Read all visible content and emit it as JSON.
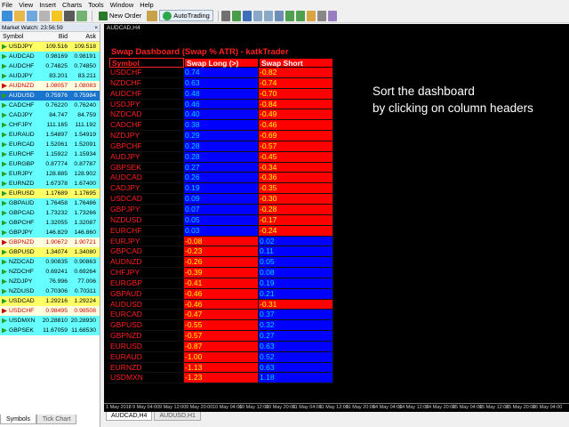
{
  "menu": [
    "File",
    "View",
    "Insert",
    "Charts",
    "Tools",
    "Window",
    "Help"
  ],
  "toolbar": {
    "new_order": "New Order",
    "autotrading": "AutoTrading"
  },
  "market_watch": {
    "title": "Market Watch: 23:56:59",
    "close": "×",
    "headers": {
      "symbol": "Symbol",
      "bid": "Bid",
      "ask": "Ask"
    },
    "rows": [
      {
        "symbol": "USDJPY",
        "bid": "109.516",
        "ask": "109.518",
        "bg": "#ffff66",
        "color": "#000000"
      },
      {
        "symbol": "AUDCAD",
        "bid": "0.98169",
        "ask": "0.98191",
        "bg": "#66ffff",
        "color": "#000000"
      },
      {
        "symbol": "AUDCHF",
        "bid": "0.74825",
        "ask": "0.74850",
        "bg": "#66ffff",
        "color": "#000000"
      },
      {
        "symbol": "AUDJPY",
        "bid": "83.201",
        "ask": "83.211",
        "bg": "#66ffff",
        "color": "#000000"
      },
      {
        "symbol": "AUDNZD",
        "bid": "1.08057",
        "ask": "1.08083",
        "bg": "#ffffe0",
        "color": "#cc0000"
      },
      {
        "symbol": "AUDUSD",
        "bid": "0.75976",
        "ask": "0.75984",
        "bg": "#1874cd",
        "color": "#ffffff"
      },
      {
        "symbol": "CADCHF",
        "bid": "0.76220",
        "ask": "0.76240",
        "bg": "#66ffff",
        "color": "#000000"
      },
      {
        "symbol": "CADJPY",
        "bid": "84.747",
        "ask": "84.759",
        "bg": "#66ffff",
        "color": "#000000"
      },
      {
        "symbol": "CHFJPY",
        "bid": "111.165",
        "ask": "111.192",
        "bg": "#66ffff",
        "color": "#000000"
      },
      {
        "symbol": "EURAUD",
        "bid": "1.54897",
        "ask": "1.54919",
        "bg": "#66ffff",
        "color": "#000000"
      },
      {
        "symbol": "EURCAD",
        "bid": "1.52061",
        "ask": "1.52091",
        "bg": "#66ffff",
        "color": "#000000"
      },
      {
        "symbol": "EURCHF",
        "bid": "1.15922",
        "ask": "1.15934",
        "bg": "#66ffff",
        "color": "#000000"
      },
      {
        "symbol": "EURGBP",
        "bid": "0.87774",
        "ask": "0.87787",
        "bg": "#66ffff",
        "color": "#000000"
      },
      {
        "symbol": "EURJPY",
        "bid": "128.885",
        "ask": "128.902",
        "bg": "#66ffff",
        "color": "#000000"
      },
      {
        "symbol": "EURNZD",
        "bid": "1.67378",
        "ask": "1.67400",
        "bg": "#66ffff",
        "color": "#000000"
      },
      {
        "symbol": "EURUSD",
        "bid": "1.17689",
        "ask": "1.17695",
        "bg": "#ffff66",
        "color": "#000000"
      },
      {
        "symbol": "GBPAUD",
        "bid": "1.76458",
        "ask": "1.76486",
        "bg": "#66ffff",
        "color": "#000000"
      },
      {
        "symbol": "GBPCAD",
        "bid": "1.73232",
        "ask": "1.73266",
        "bg": "#66ffff",
        "color": "#000000"
      },
      {
        "symbol": "GBPCHF",
        "bid": "1.32055",
        "ask": "1.32087",
        "bg": "#66ffff",
        "color": "#000000"
      },
      {
        "symbol": "GBPJPY",
        "bid": "146.829",
        "ask": "146.860",
        "bg": "#66ffff",
        "color": "#000000"
      },
      {
        "symbol": "GBPNZD",
        "bid": "1.90672",
        "ask": "1.90721",
        "bg": "#ffffe0",
        "color": "#cc0000"
      },
      {
        "symbol": "GBPUSD",
        "bid": "1.34074",
        "ask": "1.34080",
        "bg": "#ffff66",
        "color": "#000000"
      },
      {
        "symbol": "NZDCAD",
        "bid": "0.90835",
        "ask": "0.90863",
        "bg": "#66ffff",
        "color": "#000000"
      },
      {
        "symbol": "NZDCHF",
        "bid": "0.69241",
        "ask": "0.69264",
        "bg": "#66ffff",
        "color": "#000000"
      },
      {
        "symbol": "NZDJPY",
        "bid": "76.996",
        "ask": "77.006",
        "bg": "#66ffff",
        "color": "#000000"
      },
      {
        "symbol": "NZDUSD",
        "bid": "0.70306",
        "ask": "0.70311",
        "bg": "#66ffff",
        "color": "#000000"
      },
      {
        "symbol": "USDCAD",
        "bid": "1.29216",
        "ask": "1.29224",
        "bg": "#ffff66",
        "color": "#000000"
      },
      {
        "symbol": "USDCHF",
        "bid": "0.98495",
        "ask": "0.98508",
        "bg": "#ffffe0",
        "color": "#cc0000"
      },
      {
        "symbol": "USDMXN",
        "bid": "20.28810",
        "ask": "20.28930",
        "bg": "#66ffff",
        "color": "#000000"
      },
      {
        "symbol": "GBPSEK",
        "bid": "11.67059",
        "ask": "11.68530",
        "bg": "#66ffff",
        "color": "#000000"
      }
    ],
    "tabs": [
      "Symbols",
      "Tick Chart"
    ]
  },
  "chart": {
    "window_title": "AUDCAD,H4",
    "tabs": [
      "AUDCAD,H4",
      "AUDUSD,H1"
    ],
    "time_labels": [
      "1 May 2018",
      "9 May 04:00",
      "9 May 12:00",
      "9 May 20:00",
      "10 May 04:00",
      "10 May 12:00",
      "10 May 20:00",
      "11 May 04:00",
      "11 May 12:00",
      "11 May 20:00",
      "14 May 04:00",
      "14 May 12:00",
      "14 May 20:00",
      "15 May 04:00",
      "15 May 12:00",
      "15 May 20:00",
      "16 May 04:00"
    ],
    "note_line1": "Sort the dashboard",
    "note_line2": "by clicking on column headers"
  },
  "dashboard": {
    "title": "Swap Dashboard (Swap % ATR) - katkTrader",
    "headers": {
      "symbol": "Symbol",
      "long": "Swap Long (>)",
      "short": "Swap Short"
    },
    "colors": {
      "positive": "#0000ff",
      "negative": "#ff0000",
      "positive_text": "#00d4ff",
      "negative_text": "#ffff00"
    },
    "rows": [
      {
        "symbol": "USDCHF",
        "long": "0.74",
        "short": "-0.82"
      },
      {
        "symbol": "NZDCHF",
        "long": "0.63",
        "short": "-0.74"
      },
      {
        "symbol": "AUDCHF",
        "long": "0.48",
        "short": "-0.70"
      },
      {
        "symbol": "USDJPY",
        "long": "0.46",
        "short": "-0.84"
      },
      {
        "symbol": "NZDCAD",
        "long": "0.40",
        "short": "-0.49"
      },
      {
        "symbol": "CADCHF",
        "long": "0.38",
        "short": "-0.46"
      },
      {
        "symbol": "NZDJPY",
        "long": "0.29",
        "short": "-0.69"
      },
      {
        "symbol": "GBPCHF",
        "long": "0.28",
        "short": "-0.57"
      },
      {
        "symbol": "AUDJPY",
        "long": "0.28",
        "short": "-0.45"
      },
      {
        "symbol": "GBPSEK",
        "long": "0.27",
        "short": "-0.34"
      },
      {
        "symbol": "AUDCAD",
        "long": "0.26",
        "short": "-0.36"
      },
      {
        "symbol": "CADJPY",
        "long": "0.19",
        "short": "-0.35"
      },
      {
        "symbol": "USDCAD",
        "long": "0.09",
        "short": "-0.30"
      },
      {
        "symbol": "GBPJPY",
        "long": "0.07",
        "short": "-0.28"
      },
      {
        "symbol": "NZDUSD",
        "long": "0.05",
        "short": "-0.17"
      },
      {
        "symbol": "EURCHF",
        "long": "0.03",
        "short": "-0.24"
      },
      {
        "symbol": "EURJPY",
        "long": "-0.08",
        "short": "0.02"
      },
      {
        "symbol": "GBPCAD",
        "long": "-0.23",
        "short": "0.11"
      },
      {
        "symbol": "AUDNZD",
        "long": "-0.26",
        "short": "0.05"
      },
      {
        "symbol": "CHFJPY",
        "long": "-0.39",
        "short": "0.08"
      },
      {
        "symbol": "EURGBP",
        "long": "-0.41",
        "short": "0.19"
      },
      {
        "symbol": "GBPAUD",
        "long": "-0.46",
        "short": "0.21"
      },
      {
        "symbol": "AUDUSD",
        "long": "-0.46",
        "short": "-0.31"
      },
      {
        "symbol": "EURCAD",
        "long": "-0.47",
        "short": "0.37"
      },
      {
        "symbol": "GBPUSD",
        "long": "-0.55",
        "short": "0.32"
      },
      {
        "symbol": "GBPNZD",
        "long": "-0.57",
        "short": "0.27"
      },
      {
        "symbol": "EURUSD",
        "long": "-0.87",
        "short": "0.63"
      },
      {
        "symbol": "EURAUD",
        "long": "-1.00",
        "short": "0.52"
      },
      {
        "symbol": "EURNZD",
        "long": "-1.13",
        "short": "0.63"
      },
      {
        "symbol": "USDMXN",
        "long": "-1.23",
        "short": "1.18"
      }
    ]
  }
}
